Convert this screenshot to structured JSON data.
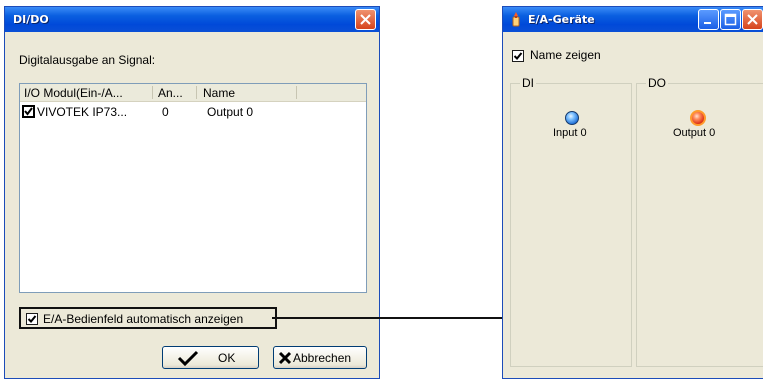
{
  "dido_dialog": {
    "title": "DI/DO",
    "signal_label": "Digitalausgabe an Signal:",
    "columns": [
      "I/O Modul(Ein-/A...",
      "An...",
      "Name"
    ],
    "rows": [
      {
        "checked": true,
        "module": "VIVOTEK IP73...",
        "number": "0",
        "name": "Output 0"
      }
    ],
    "auto_show_checked": true,
    "auto_show_label": "E/A-Bedienfeld automatisch anzeigen",
    "ok_label": "OK",
    "cancel_label": "Abbrechen"
  },
  "ea_window": {
    "title": "E/A-Geräte",
    "show_name_checked": true,
    "show_name_label": "Name zeigen",
    "di_group": {
      "label": "DI",
      "items": [
        {
          "label": "Input 0",
          "led": "blue"
        }
      ]
    },
    "do_group": {
      "label": "DO",
      "items": [
        {
          "label": "Output 0",
          "led": "red"
        }
      ]
    }
  },
  "colors": {
    "titlebar": "#0a5fe0",
    "close_button": "#d6431c",
    "window_bg": "#ece9d8",
    "input_led": "#1f6fd6",
    "output_led": "#d92b10"
  }
}
